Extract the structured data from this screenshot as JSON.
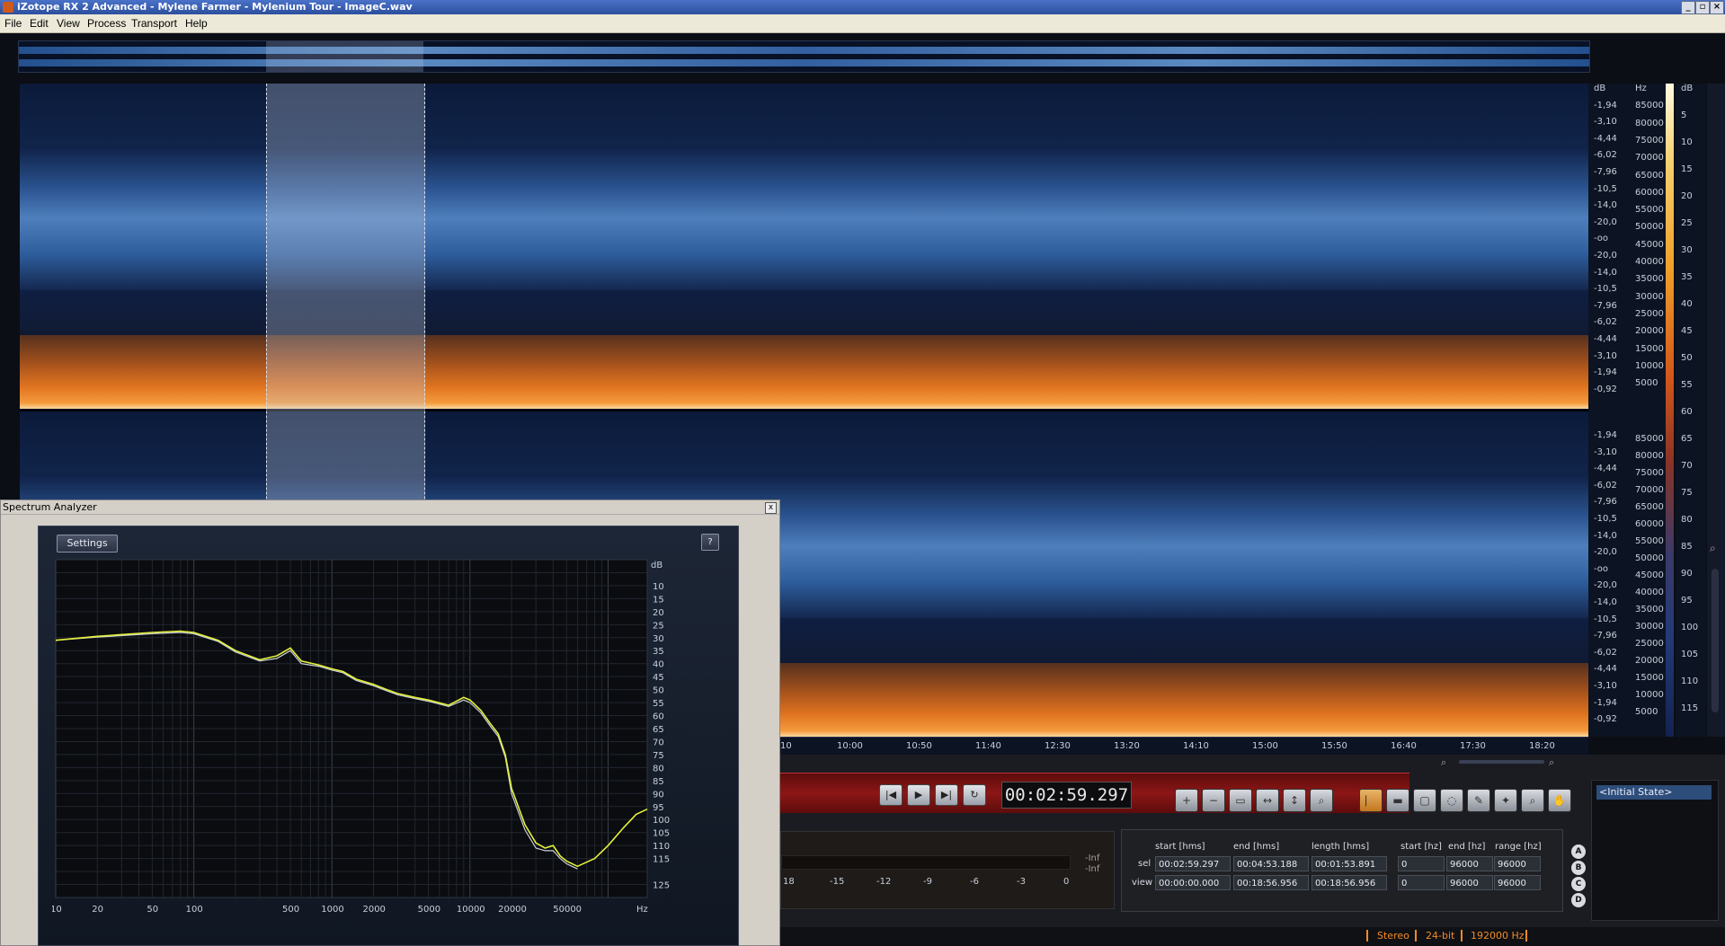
{
  "window": {
    "title": "iZotope RX 2 Advanced - Mylene Farmer - Mylenium Tour - ImageC.wav"
  },
  "menu": [
    "File",
    "Edit",
    "View",
    "Process",
    "Transport",
    "Help"
  ],
  "db_scale_top": [
    "dB",
    "-1,94",
    "-3,10",
    "-4,44",
    "-6,02",
    "-7,96",
    "-10,5",
    "-14,0",
    "-20,0",
    "-oo",
    "-20,0",
    "-14,0",
    "-10,5",
    "-7,96",
    "-6,02",
    "-4,44",
    "-3,10",
    "-1,94",
    "-0,92"
  ],
  "db_scale_bottom": [
    "-1,94",
    "-3,10",
    "-4,44",
    "-6,02",
    "-7,96",
    "-10,5",
    "-14,0",
    "-20,0",
    "-oo",
    "-20,0",
    "-14,0",
    "-10,5",
    "-7,96",
    "-6,02",
    "-4,44",
    "-3,10",
    "-1,94",
    "-0,92"
  ],
  "hz_scale_top": [
    "Hz",
    "85000",
    "80000",
    "75000",
    "70000",
    "65000",
    "60000",
    "55000",
    "50000",
    "45000",
    "40000",
    "35000",
    "30000",
    "25000",
    "20000",
    "15000",
    "10000",
    "5000"
  ],
  "hz_scale_bottom": [
    "85000",
    "80000",
    "75000",
    "70000",
    "65000",
    "60000",
    "55000",
    "50000",
    "45000",
    "40000",
    "35000",
    "30000",
    "25000",
    "20000",
    "15000",
    "10000",
    "5000"
  ],
  "colorbar_scale": [
    "dB",
    "5",
    "10",
    "15",
    "20",
    "25",
    "30",
    "35",
    "40",
    "45",
    "50",
    "55",
    "60",
    "65",
    "70",
    "75",
    "80",
    "85",
    "90",
    "95",
    "100",
    "105",
    "110",
    "115"
  ],
  "timeline": [
    "10",
    "10:00",
    "10:50",
    "11:40",
    "12:30",
    "13:20",
    "14:10",
    "15:00",
    "15:50",
    "16:40",
    "17:30",
    "18:20"
  ],
  "transport": {
    "timecode": "00:02:59.297"
  },
  "meter": {
    "labels": [
      "18",
      "-15",
      "-12",
      "-9",
      "-6",
      "-3",
      "0"
    ],
    "inf1": "-Inf",
    "inf2": "-Inf"
  },
  "selection": {
    "headers": {
      "start_hms": "start [hms]",
      "end_hms": "end [hms]",
      "length_hms": "length [hms]",
      "start_hz": "start [hz]",
      "end_hz": "end [hz]",
      "range_hz": "range [hz]"
    },
    "sel": {
      "label": "sel",
      "start": "00:02:59.297",
      "end": "00:04:53.188",
      "length": "00:01:53.891",
      "start_hz": "0",
      "end_hz": "96000",
      "range_hz": "96000"
    },
    "view": {
      "label": "view",
      "start": "00:00:00.000",
      "end": "00:18:56.956",
      "length": "00:18:56.956",
      "start_hz": "0",
      "end_hz": "96000",
      "range_hz": "96000"
    }
  },
  "abcd": [
    "A",
    "B",
    "C",
    "D"
  ],
  "history": {
    "item": "<Initial State>"
  },
  "status": {
    "channels": "Stereo",
    "bitdepth": "24-bit",
    "rate": "192000 Hz"
  },
  "spectrum_analyzer": {
    "title": "Spectrum Analyzer",
    "settings_label": "Settings",
    "help_label": "?",
    "close_label": "x",
    "chart_data": {
      "type": "line",
      "xscale": "log",
      "xlim": [
        10,
        192000
      ],
      "ylim": [
        0,
        130
      ],
      "ylabel": "dB",
      "xlabel": "Hz",
      "y_ticks": [
        "10",
        "15",
        "20",
        "25",
        "30",
        "35",
        "40",
        "45",
        "50",
        "55",
        "60",
        "65",
        "70",
        "75",
        "80",
        "85",
        "90",
        "95",
        "100",
        "105",
        "110",
        "115",
        "125"
      ],
      "x_ticks": [
        "10",
        "20",
        "50",
        "100",
        "500",
        "1000",
        "2000",
        "5000",
        "10000",
        "20000",
        "50000"
      ],
      "series": [
        {
          "color": "#e4f03a",
          "x": [
            10,
            20,
            50,
            80,
            100,
            150,
            200,
            300,
            400,
            500,
            600,
            800,
            1000,
            1200,
            1500,
            2000,
            2500,
            3000,
            4000,
            5000,
            7000,
            9000,
            10000,
            12000,
            14000,
            16000,
            18000,
            20000,
            25000,
            30000,
            35000,
            40000,
            45000,
            50000,
            60000,
            80000,
            100000,
            130000,
            160000,
            192000
          ],
          "y": [
            31,
            29.5,
            28,
            27.5,
            28,
            31,
            35,
            38.5,
            37,
            34,
            39,
            40.5,
            42,
            43,
            46,
            48,
            50,
            51.5,
            53,
            54,
            56,
            53,
            54,
            58,
            63,
            67,
            75,
            88,
            102,
            109,
            111,
            110,
            114,
            116,
            118,
            115,
            110,
            103,
            98,
            96
          ]
        },
        {
          "color": "#c9d2d8",
          "x": [
            10,
            20,
            50,
            80,
            100,
            150,
            200,
            300,
            400,
            500,
            600,
            800,
            1000,
            1200,
            1500,
            2000,
            2500,
            3000,
            4000,
            5000,
            7000,
            9000,
            10000,
            12000,
            14000,
            16000,
            18000,
            20000,
            25000,
            30000,
            35000,
            40000,
            45000,
            50000,
            60000
          ],
          "y": [
            31,
            29.8,
            28.5,
            28,
            28.5,
            31.5,
            35.5,
            39,
            38,
            35,
            40,
            41,
            42.5,
            43.5,
            46.5,
            48.5,
            50.5,
            52,
            53.5,
            54.5,
            56.5,
            54,
            55,
            59,
            64,
            68,
            76,
            90,
            104,
            111,
            112,
            112,
            115,
            117,
            119
          ]
        }
      ]
    }
  },
  "colors": {
    "accent_orange": "#f08a2a",
    "trace_yellow": "#e4f03a",
    "transport_red": "#8c1616"
  }
}
